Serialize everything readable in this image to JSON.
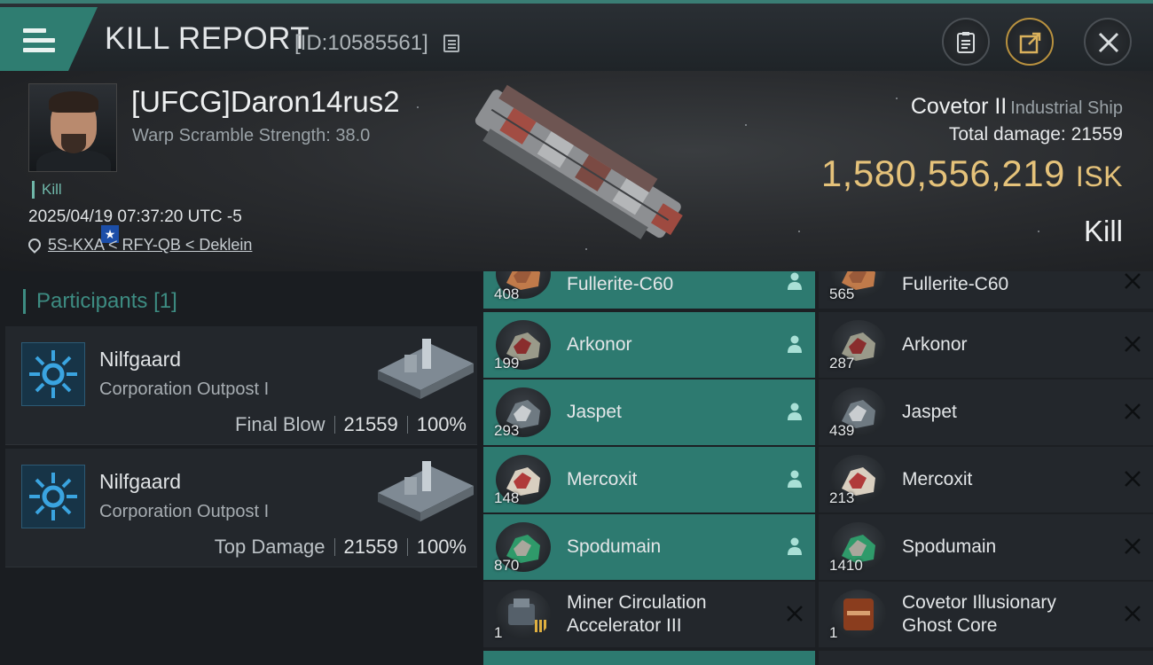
{
  "header": {
    "title": "KILL REPORT",
    "kill_id": "[ID:10585561]",
    "menu_icon": "hamburger-icon",
    "buttons": [
      "clipboard-icon",
      "share-icon",
      "close-icon"
    ]
  },
  "victim": {
    "name": "[UFCG]Daron14rus2",
    "warp_scramble": "Warp Scramble Strength: 38.0",
    "tag": "Kill",
    "datetime": "2025/04/19 07:37:20 UTC -5",
    "location": "5S-KXA < RFY-QB < Deklein",
    "ship_name": "Covetor II",
    "ship_class": "Industrial Ship",
    "total_damage_label": "Total damage:",
    "total_damage": "21559",
    "isk_value": "1,580,556,219",
    "isk_unit": "ISK",
    "result": "Kill"
  },
  "participants": {
    "title": "Participants",
    "count": "[1]",
    "rows": [
      {
        "corp": "Nilfgaard",
        "ship": "Corporation Outpost I",
        "label": "Final Blow",
        "damage": "21559",
        "percent": "100%"
      },
      {
        "corp": "Nilfgaard",
        "ship": "Corporation Outpost I",
        "label": "Top Damage",
        "damage": "21559",
        "percent": "100%"
      }
    ]
  },
  "items": {
    "left": [
      {
        "name": "Fullerite-C60",
        "qty": "408",
        "status": "dropped"
      },
      {
        "name": "Arkonor",
        "qty": "199",
        "status": "dropped"
      },
      {
        "name": "Jaspet",
        "qty": "293",
        "status": "dropped"
      },
      {
        "name": "Mercoxit",
        "qty": "148",
        "status": "dropped"
      },
      {
        "name": "Spodumain",
        "qty": "870",
        "status": "dropped"
      },
      {
        "name": "Miner Circulation Accelerator III",
        "line1": "Miner Circulation",
        "line2": "Accelerator III",
        "qty": "1",
        "status": "destroyed"
      }
    ],
    "right": [
      {
        "name": "Fullerite-C60",
        "qty": "565",
        "status": "destroyed"
      },
      {
        "name": "Arkonor",
        "qty": "287",
        "status": "destroyed"
      },
      {
        "name": "Jaspet",
        "qty": "439",
        "status": "destroyed"
      },
      {
        "name": "Mercoxit",
        "qty": "213",
        "status": "destroyed"
      },
      {
        "name": "Spodumain",
        "qty": "1410",
        "status": "destroyed"
      },
      {
        "name": "Covetor Illusionary Ghost Core",
        "line1": "Covetor Illusionary",
        "line2": "Ghost Core",
        "qty": "1",
        "status": "destroyed"
      }
    ]
  },
  "colors": {
    "accent": "#2d7a70",
    "isk": "#e5c27a",
    "participants_title": "#3d8c82"
  }
}
